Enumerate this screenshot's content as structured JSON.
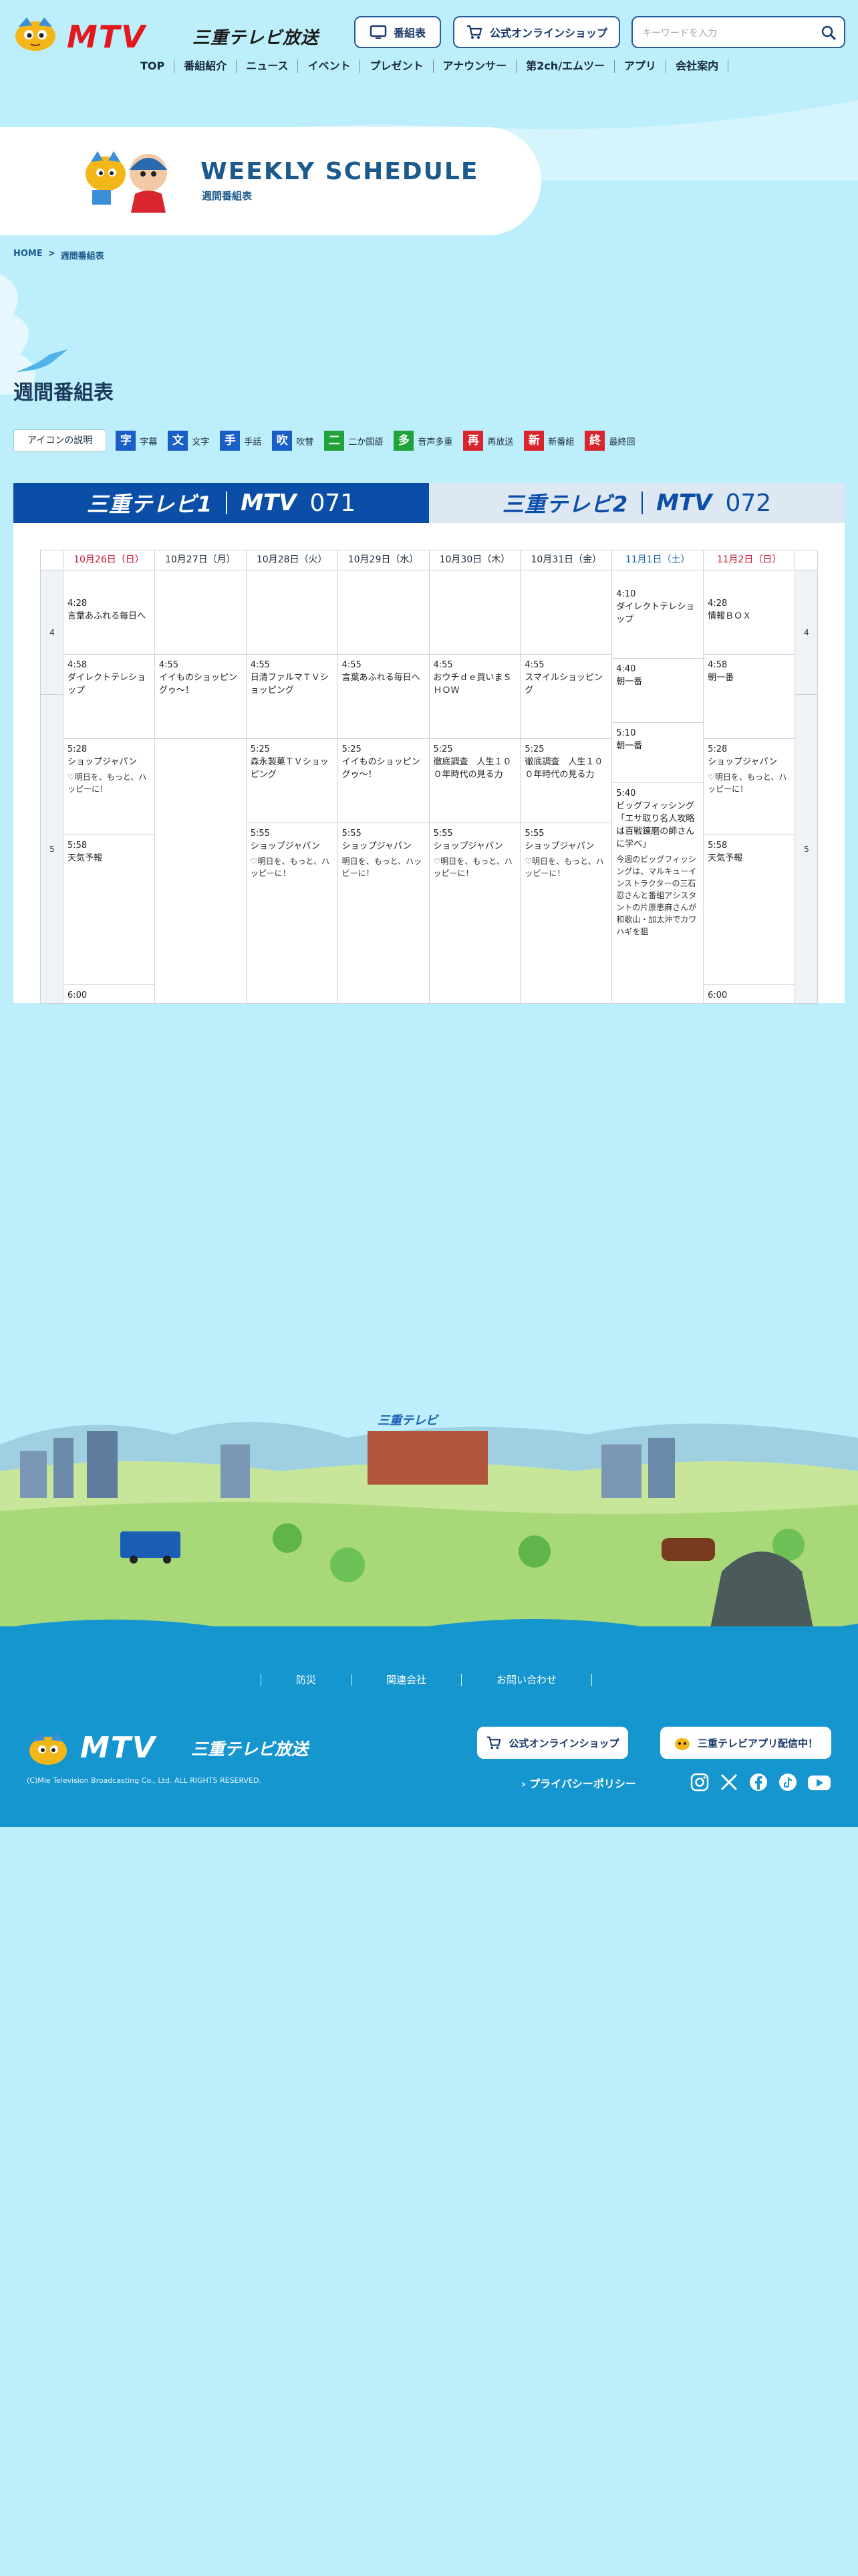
{
  "header": {
    "logo_text": "MTV",
    "logo_sub": "三重テレビ放送",
    "btn_program": "番組表",
    "btn_shop": "公式オンラインショップ",
    "search_placeholder": "キーワードを入力"
  },
  "gnav": [
    "TOP",
    "番組紹介",
    "ニュース",
    "イベント",
    "プレゼント",
    "アナウンサー",
    "第2ch/エムツー",
    "アプリ",
    "会社案内"
  ],
  "hero": {
    "title": "WEEKLY SCHEDULE",
    "subtitle": "週間番組表"
  },
  "breadcrumb": {
    "home": "HOME",
    "sep": ">",
    "current": "週間番組表"
  },
  "section_title": "週間番組表",
  "legend": {
    "explain": "アイコンの説明",
    "items": [
      {
        "icon": "字",
        "label": "字幕",
        "color": "#1a5fc8"
      },
      {
        "icon": "文",
        "label": "文字",
        "color": "#1a5fc8"
      },
      {
        "icon": "手",
        "label": "手話",
        "color": "#1a5fc8"
      },
      {
        "icon": "吹",
        "label": "吹替",
        "color": "#1a5fc8"
      },
      {
        "icon": "二",
        "label": "二か国語",
        "color": "#21a33a"
      },
      {
        "icon": "多",
        "label": "音声多重",
        "color": "#21a33a"
      },
      {
        "icon": "再",
        "label": "再放送",
        "color": "#d9262e"
      },
      {
        "icon": "新",
        "label": "新番組",
        "color": "#d9262e"
      },
      {
        "icon": "終",
        "label": "最終回",
        "color": "#d9262e"
      }
    ]
  },
  "channels": [
    {
      "name": "三重テレビ1",
      "brand": "MTV",
      "number": "071",
      "active": true
    },
    {
      "name": "三重テレビ2",
      "brand": "MTV",
      "number": "072",
      "active": false
    }
  ],
  "schedule": {
    "hours": [
      "4",
      "5"
    ],
    "days": [
      {
        "label": "10月26日（日）",
        "kind": "sun",
        "programs": [
          {
            "time": "4:28",
            "title": "言葉あふれる毎日へ"
          },
          {
            "time": "4:58",
            "title": "ダイレクトテレショップ"
          },
          {
            "time": "5:28",
            "title": "ショップジャパン",
            "desc": "♡明日を、もっと、ハッピーに！"
          },
          {
            "time": "5:58",
            "title": "天気予報"
          },
          {
            "time": "6:00",
            "title": ""
          }
        ]
      },
      {
        "label": "10月27日（月）",
        "kind": "",
        "programs": [
          {
            "time": "",
            "title": ""
          },
          {
            "time": "4:55",
            "title": "イイものショッピングゥ～！"
          }
        ]
      },
      {
        "label": "10月28日（火）",
        "kind": "",
        "programs": [
          {
            "time": "",
            "title": ""
          },
          {
            "time": "4:55",
            "title": "日清ファルマＴＶショッピング"
          },
          {
            "time": "5:25",
            "title": "森永製菓ＴＶショッピング"
          },
          {
            "time": "5:55",
            "title": "ショップジャパン",
            "desc": "♡明日を、もっと、ハッピーに！"
          }
        ]
      },
      {
        "label": "10月29日（水）",
        "kind": "",
        "programs": [
          {
            "time": "",
            "title": ""
          },
          {
            "time": "4:55",
            "title": "言葉あふれる毎日へ"
          },
          {
            "time": "5:25",
            "title": "イイものショッピングゥ～！"
          },
          {
            "time": "5:55",
            "title": "ショップジャパン",
            "desc": "明日を、もっと、ハッピーに！"
          }
        ]
      },
      {
        "label": "10月30日（木）",
        "kind": "",
        "programs": [
          {
            "time": "",
            "title": ""
          },
          {
            "time": "4:55",
            "title": "おウチｄｅ買いまＳＨＯＷ"
          },
          {
            "time": "5:25",
            "title": "徹底調査　人生１００年時代の見る力"
          },
          {
            "time": "5:55",
            "title": "ショップジャパン",
            "desc": "♡明日を、もっと、ハッピーに！"
          }
        ]
      },
      {
        "label": "10月31日（金）",
        "kind": "",
        "programs": [
          {
            "time": "",
            "title": ""
          },
          {
            "time": "4:55",
            "title": "スマイルショッピング"
          },
          {
            "time": "5:25",
            "title": "徹底調査　人生１００年時代の見る力"
          },
          {
            "time": "5:55",
            "title": "ショップジャパン",
            "desc": "♡明日を、もっと、ハッピーに！"
          }
        ]
      },
      {
        "label": "11月1日（土）",
        "kind": "sat",
        "programs": [
          {
            "time": "4:10",
            "title": "ダイレクトテレショップ"
          },
          {
            "time": "4:40",
            "title": "朝一番"
          },
          {
            "time": "5:10",
            "title": "朝一番"
          },
          {
            "time": "5:40",
            "title": "ビッグフィッシング 「エサ取り名人攻略は百戦錬磨の師さんに学べ」",
            "desc": "今週のビッグフィッシングは、マルキューインストラクターの三石忍さんと番組アシスタントの片原恵麻さんが和歌山・加太沖でカワハギを狙"
          }
        ]
      },
      {
        "label": "11月2日（日）",
        "kind": "sun",
        "programs": [
          {
            "time": "4:28",
            "title": "情報ＢＯＸ"
          },
          {
            "time": "4:58",
            "title": "朝一番"
          },
          {
            "time": "5:28",
            "title": "ショップジャパン",
            "desc": "♡明日を、もっと、ハッピーに！"
          },
          {
            "time": "5:58",
            "title": "天気予報"
          },
          {
            "time": "6:00",
            "title": ""
          }
        ]
      }
    ]
  },
  "footer": {
    "nav": [
      "防災",
      "関連会社",
      "お問い合わせ"
    ],
    "logo_text": "MTV",
    "logo_sub": "三重テレビ放送",
    "copyright": "(C)Mie Television Broadcasting Co., Ltd. ALL RIGHTS RESERVED.",
    "btn_shop": "公式オンラインショップ",
    "btn_app": "三重テレビアプリ配信中！",
    "privacy": "› プライバシーポリシー",
    "building_sign": "三重テレビ"
  }
}
